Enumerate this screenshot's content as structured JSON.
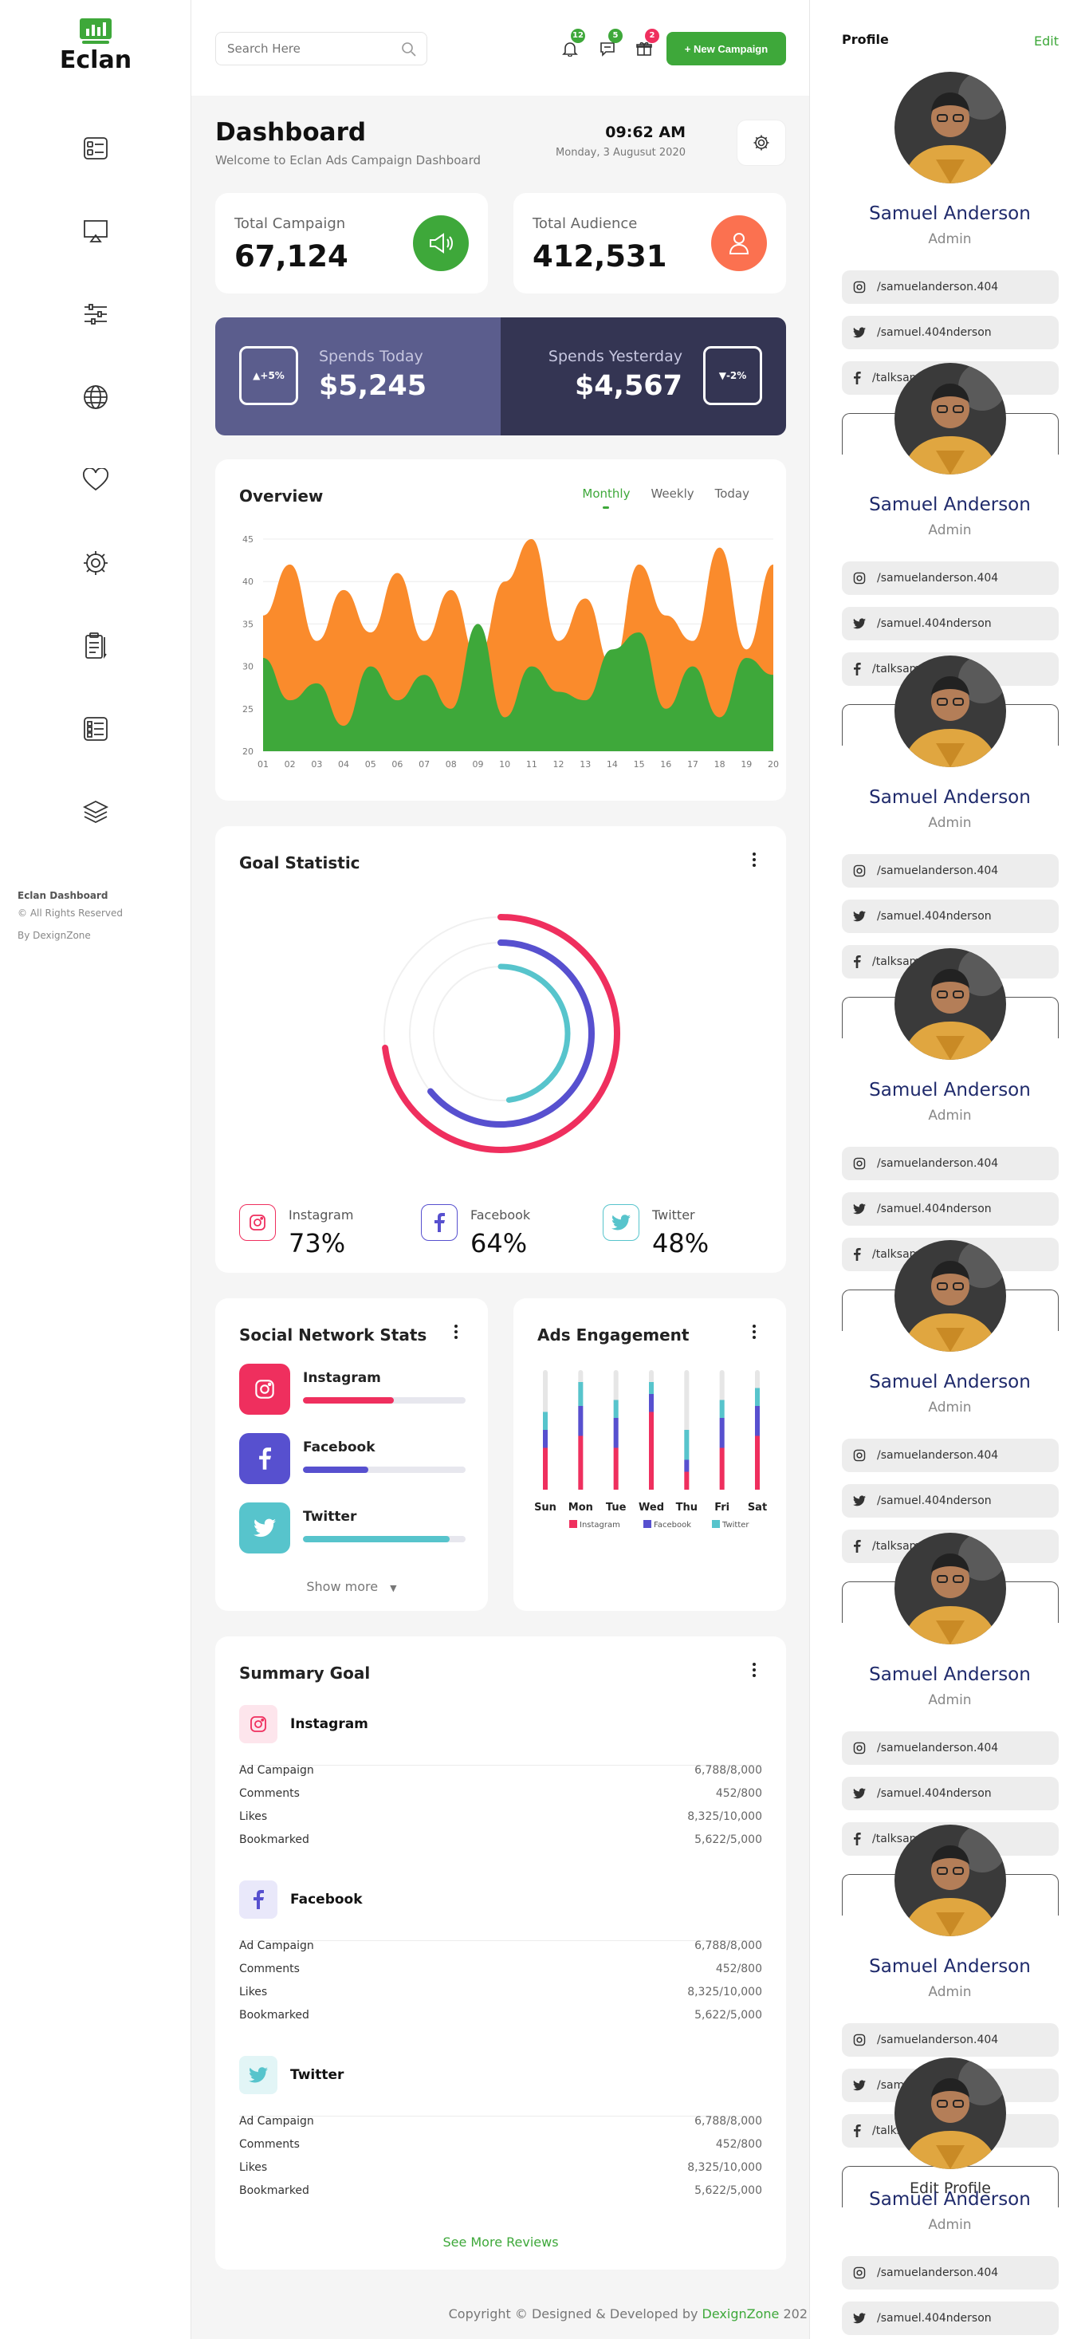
{
  "brand": {
    "name": "Eclan"
  },
  "sidebar": {
    "nav": [
      "dashboard-icon",
      "presentation-icon",
      "sliders-icon",
      "globe-icon",
      "heart-icon",
      "settings-icon",
      "clipboard-icon",
      "list-icon",
      "layers-icon"
    ],
    "footer_title": "Eclan Dashboard",
    "footer_rights": "© All Rights Reserved",
    "footer_by": "By DexignZone"
  },
  "topbar": {
    "search_placeholder": "Search Here",
    "notif_bell": "12",
    "notif_chat": "5",
    "notif_gift": "2",
    "new_campaign": "+ New Campaign"
  },
  "header": {
    "title": "Dashboard",
    "subtitle": "Welcome to Eclan Ads Campaign Dashboard",
    "time": "09:62 AM",
    "date": "Monday, 3 Augusut 2020"
  },
  "stats": {
    "campaign_label": "Total Campaign",
    "campaign_value": "67,124",
    "audience_label": "Total Audience",
    "audience_value": "412,531"
  },
  "spends": {
    "today_label": "Spends Today",
    "today_value": "$5,245",
    "today_change": "+5%",
    "yesterday_label": "Spends Yesterday",
    "yesterday_value": "$4,567",
    "yesterday_change": "-2%"
  },
  "overview": {
    "title": "Overview",
    "tabs": [
      "Monthly",
      "Weekly",
      "Today"
    ]
  },
  "chart_data": [
    {
      "type": "area",
      "x": [
        "01",
        "02",
        "03",
        "04",
        "05",
        "06",
        "07",
        "08",
        "09",
        "10",
        "11",
        "12",
        "13",
        "14",
        "15",
        "16",
        "17",
        "18",
        "19",
        "20"
      ],
      "ylim": [
        20,
        45
      ],
      "yticks": [
        20,
        25,
        30,
        35,
        40,
        45
      ],
      "colors": [
        "#fa8b2c",
        "#3ea83a"
      ],
      "series": [
        {
          "values": [
            36,
            42,
            33,
            39,
            34,
            41,
            33,
            39,
            31,
            40,
            45,
            33,
            38,
            30,
            42,
            36,
            33,
            44,
            32,
            42
          ]
        },
        {
          "values": [
            31,
            26,
            28,
            23,
            30,
            26,
            29,
            25,
            35,
            24,
            30,
            27,
            26,
            32,
            34,
            25,
            30,
            24,
            31,
            29
          ]
        }
      ]
    },
    {
      "type": "bar",
      "categories": [
        "Sun",
        "Mon",
        "Tue",
        "Wed",
        "Thu",
        "Fri",
        "Sat"
      ],
      "colors": [
        "#ef2f5e",
        "#5750cf",
        "#57c4cc",
        "#e6e6e6"
      ],
      "series": [
        {
          "name": "Instagram",
          "values": [
            35,
            45,
            35,
            65,
            15,
            35,
            45
          ]
        },
        {
          "name": "Facebook",
          "values": [
            15,
            25,
            25,
            15,
            10,
            25,
            25
          ]
        },
        {
          "name": "Twitter",
          "values": [
            15,
            20,
            15,
            10,
            25,
            15,
            15
          ]
        }
      ],
      "max": 100
    },
    {
      "type": "pie",
      "categories": [
        "Instagram",
        "Facebook",
        "Twitter"
      ],
      "values": [
        73,
        64,
        48
      ],
      "colors": [
        "#ef2f5e",
        "#5750cf",
        "#57c4cc"
      ]
    }
  ],
  "goal": {
    "title": "Goal Statistic",
    "items": [
      {
        "name": "Instagram",
        "value": "73%"
      },
      {
        "name": "Facebook",
        "value": "64%"
      },
      {
        "name": "Twitter",
        "value": "48%"
      }
    ]
  },
  "social": {
    "title": "Social Network Stats",
    "items": [
      {
        "name": "Instagram",
        "progress": 0.56
      },
      {
        "name": "Facebook",
        "progress": 0.4
      },
      {
        "name": "Twitter",
        "progress": 0.9
      }
    ],
    "show_more": "Show more"
  },
  "ads": {
    "title": "Ads Engagement"
  },
  "summary": {
    "title": "Summary Goal",
    "groups": [
      {
        "name": "Instagram",
        "rows": [
          [
            "Ad Campaign",
            "6,788/8,000"
          ],
          [
            "Comments",
            "452/800"
          ],
          [
            "Likes",
            "8,325/10,000"
          ],
          [
            "Bookmarked",
            "5,622/5,000"
          ]
        ]
      },
      {
        "name": "Facebook",
        "rows": [
          [
            "Ad Campaign",
            "6,788/8,000"
          ],
          [
            "Comments",
            "452/800"
          ],
          [
            "Likes",
            "8,325/10,000"
          ],
          [
            "Bookmarked",
            "5,622/5,000"
          ]
        ]
      },
      {
        "name": "Twitter",
        "rows": [
          [
            "Ad Campaign",
            "6,788/8,000"
          ],
          [
            "Comments",
            "452/800"
          ],
          [
            "Likes",
            "8,325/10,000"
          ],
          [
            "Bookmarked",
            "5,622/5,000"
          ]
        ]
      }
    ],
    "see_more": "See More Reviews"
  },
  "footer": {
    "text": "Copyright © Designed & Developed by ",
    "brand": "DexignZone",
    "year": "202"
  },
  "profile": {
    "title": "Profile",
    "edit": "Edit",
    "name": "Samuel Anderson",
    "role": "Admin",
    "instagram": "/samuelanderson.404",
    "twitter": "/samuel.404nderson",
    "facebook": "/talksamuel.404",
    "edit_profile": "Edit Profile"
  }
}
